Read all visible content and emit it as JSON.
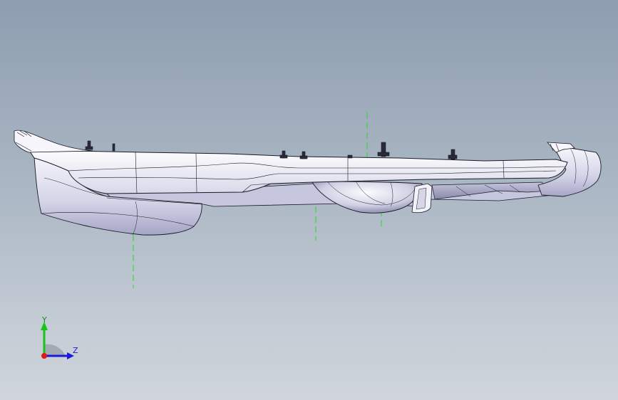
{
  "viewport": {
    "background_top": "#8e9db0",
    "background_bottom": "#cfd5db"
  },
  "model": {
    "body_color": "#ececf6",
    "shade_color": "#b8b8d4",
    "edge_color": "#1a1a26",
    "centerline_color": "#22dd22"
  },
  "triad": {
    "y_label": "Y",
    "z_label": "Z",
    "y_color": "#19c419",
    "z_color": "#1a1ad8",
    "x_color": "#e01818"
  }
}
